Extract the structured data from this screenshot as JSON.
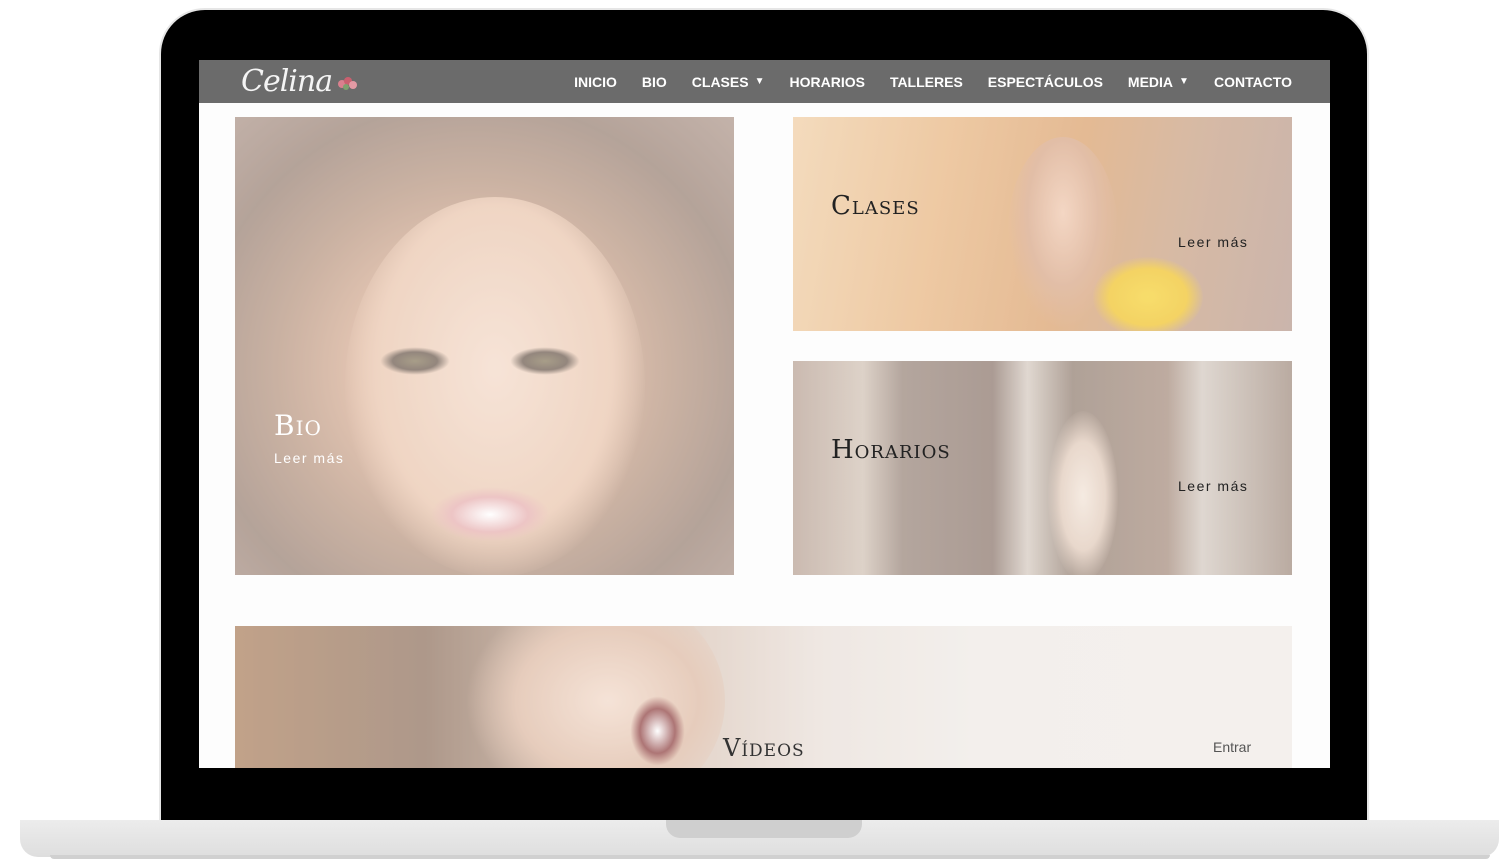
{
  "nav": {
    "logo_text": "Celina",
    "items": [
      {
        "label": "INICIO",
        "dropdown": false
      },
      {
        "label": "BIO",
        "dropdown": false
      },
      {
        "label": "CLASES",
        "dropdown": true
      },
      {
        "label": "HORARIOS",
        "dropdown": false
      },
      {
        "label": "TALLERES",
        "dropdown": false
      },
      {
        "label": "ESPECTÁCULOS",
        "dropdown": false
      },
      {
        "label": "MEDIA",
        "dropdown": true
      },
      {
        "label": "CONTACTO",
        "dropdown": false
      }
    ],
    "chevron": "⌄"
  },
  "tiles": {
    "bio": {
      "title": "Bio",
      "link": "Leer más"
    },
    "clases": {
      "title": "Clases",
      "link": "Leer más"
    },
    "horarios": {
      "title": "Horarios",
      "link": "Leer más"
    },
    "videos": {
      "title": "Vídeos",
      "link": "Entrar"
    }
  },
  "colors": {
    "navbar": "#6b6b6b",
    "frame": "#000000",
    "tile_text_light": "#ffffff",
    "tile_text_dark": "#2a2a2a"
  }
}
